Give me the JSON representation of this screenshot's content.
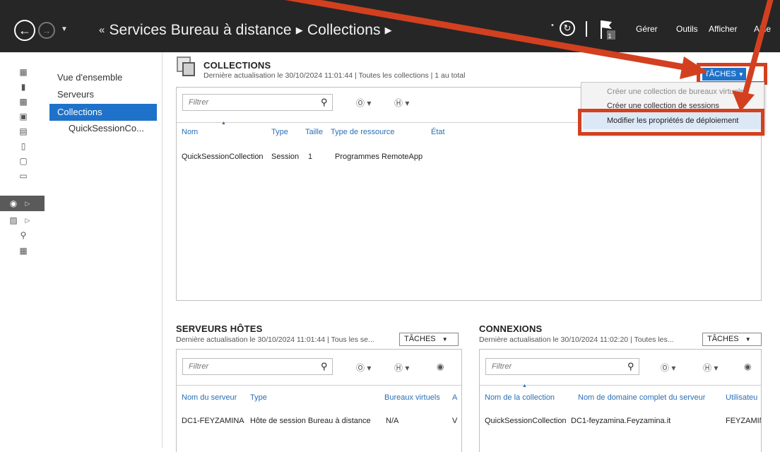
{
  "titlebar": {
    "breadcrumb_prefix": "«",
    "breadcrumb_root": "Services Bureau à distance",
    "breadcrumb_current": "Collections",
    "menu_gerer": "Gérer",
    "menu_outils": "Outils",
    "menu_afficher": "Afficher",
    "menu_aide": "Aide",
    "flag_count": "1"
  },
  "nav": {
    "items": [
      {
        "label": "Vue d'ensemble"
      },
      {
        "label": "Serveurs"
      },
      {
        "label": "Collections"
      },
      {
        "label": "QuickSessionCo..."
      }
    ]
  },
  "collections": {
    "title": "COLLECTIONS",
    "subtitle": "Dernière actualisation le 30/10/2024 11:01:44 | Toutes les collections | 1 au total",
    "tasks_label": "TÂCHES",
    "filter_placeholder": "Filtrer",
    "columns": [
      "Nom",
      "Type",
      "Taille",
      "Type de ressource",
      "État"
    ],
    "rows": [
      {
        "nom": "QuickSessionCollection",
        "type": "Session",
        "taille": "1",
        "ressource": "Programmes RemoteApp",
        "etat": ""
      }
    ]
  },
  "tasks_menu": {
    "items": [
      {
        "label": "Créer une collection de bureaux virtuels"
      },
      {
        "label": "Créer une collection de sessions"
      },
      {
        "label": "Modifier les propriétés de déploiement"
      }
    ]
  },
  "hosts": {
    "title": "SERVEURS HÔTES",
    "subtitle": "Dernière actualisation le 30/10/2024 11:01:44 | Tous les se...",
    "tasks_label": "TÂCHES",
    "filter_placeholder": "Filtrer",
    "columns": [
      "Nom du serveur",
      "Type",
      "Bureaux virtuels",
      "A"
    ],
    "rows": [
      {
        "serveur": "DC1-FEYZAMINA",
        "type": "Hôte de session Bureau à distance",
        "bureaux": "N/A",
        "a": "V"
      }
    ]
  },
  "connections": {
    "title": "CONNEXIONS",
    "subtitle": "Dernière actualisation le 30/10/2024 11:02:20 | Toutes les...",
    "tasks_label": "TÂCHES",
    "filter_placeholder": "Filtrer",
    "columns": [
      "Nom de la collection",
      "Nom de domaine complet du serveur",
      "Utilisateu"
    ],
    "rows": [
      {
        "collection": "QuickSessionCollection",
        "fqdn": "DC1-feyzamina.Feyzamina.it",
        "user": "FEYZAMIN"
      }
    ]
  },
  "colors": {
    "titlebar_bg": "#262626",
    "selection": "#1f72c9",
    "link_header": "#2a6fb5",
    "annotation_red": "#d2401f"
  }
}
